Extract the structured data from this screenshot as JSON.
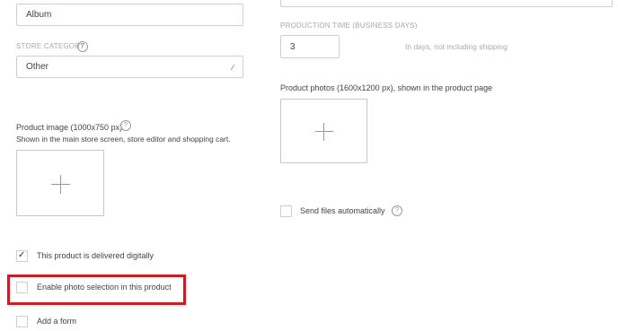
{
  "left": {
    "name_field_value": "Album",
    "store_category_label": "STORE CATEGORY",
    "store_category_value": "Other",
    "product_image_label": "Product image (1000x750 px)",
    "product_image_hint": "Shown in the main store screen, store editor and shopping cart.",
    "checkboxes": [
      {
        "label": "This product is delivered digitally",
        "checked": true
      },
      {
        "label": "Enable photo selection in this product",
        "checked": false
      },
      {
        "label": "Add a form",
        "checked": false
      }
    ]
  },
  "right": {
    "production_time_label": "PRODUCTION TIME (BUSINESS DAYS)",
    "production_time_value": "3",
    "production_time_hint": "In days, not including shipping",
    "product_photos_label": "Product photos (1600x1200 px), shown in the product page",
    "send_files_label": "Send files automatically"
  },
  "icons": {
    "help": "?",
    "check": "✓",
    "plus": "+",
    "dropdown_arrow": "⟋"
  },
  "colors": {
    "highlight": "#d7191f"
  }
}
